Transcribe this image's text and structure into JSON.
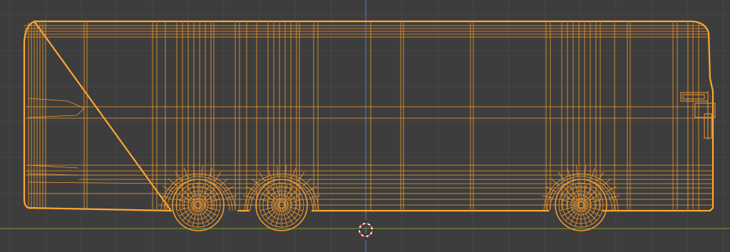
{
  "viewport": {
    "view": "side-orthographic",
    "shading": "wireframe",
    "object_type": "bus",
    "object_selected": true
  },
  "colors": {
    "background": "#3d3d3d",
    "grid_minor": "#484848",
    "grid_major": "#525252",
    "wire_selected": "#f29a2e",
    "wire_outline": "#ffa733",
    "axis_x": "#6f8f3c",
    "axis_z": "#4a6fa8",
    "cursor_red": "#e04040",
    "cursor_white": "#ffffff"
  },
  "icons": [
    "3d-cursor-icon"
  ]
}
